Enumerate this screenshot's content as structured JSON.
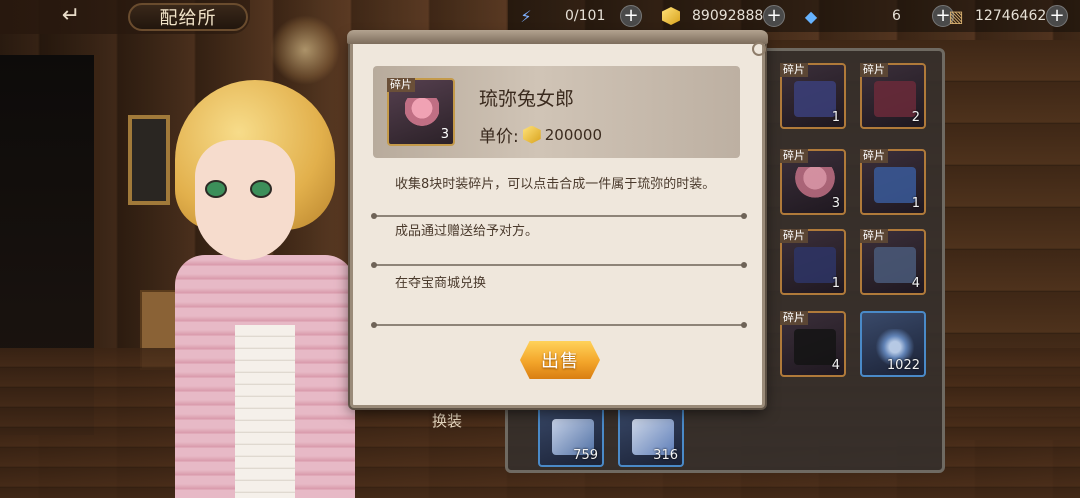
{
  "header": {
    "back_icon": "back-arrow-icon",
    "title": "配给所"
  },
  "resources": [
    {
      "icon": "lightning-icon",
      "value": "0/101"
    },
    {
      "icon": "gold-coin-icon",
      "value": "89092888"
    },
    {
      "icon": "blue-crystal-icon",
      "value": "6"
    },
    {
      "icon": "ticket-icon",
      "value": "12746462"
    }
  ],
  "modal": {
    "item": {
      "tag": "碎片",
      "count": "3",
      "name": "琉弥兔女郎",
      "price_label": "单价:",
      "price_value": "200000"
    },
    "descriptions": [
      "收集8块时装碎片，可以点击合成一件属于琉弥的时装。",
      "成品通过赠送给予对方。",
      "在夺宝商城兑换"
    ],
    "sell_label": "出售"
  },
  "inventory": {
    "slots": [
      {
        "tag": "碎片",
        "count": "1"
      },
      {
        "tag": "碎片",
        "count": "2"
      },
      {
        "tag": "碎片",
        "count": "3"
      },
      {
        "tag": "碎片",
        "count": "1"
      },
      {
        "tag": "碎片",
        "count": "1"
      },
      {
        "tag": "碎片",
        "count": "4"
      },
      {
        "tag": "碎片",
        "count": "4"
      },
      {
        "tag": "",
        "count": "1022"
      },
      {
        "tag": "",
        "count": "759"
      },
      {
        "tag": "",
        "count": "316"
      }
    ]
  },
  "bottom_label": "换装",
  "colors": {
    "accent_gold": "#f3a52a",
    "panel_bg": "#efe7dc",
    "slot_border": "#b07a3a"
  }
}
